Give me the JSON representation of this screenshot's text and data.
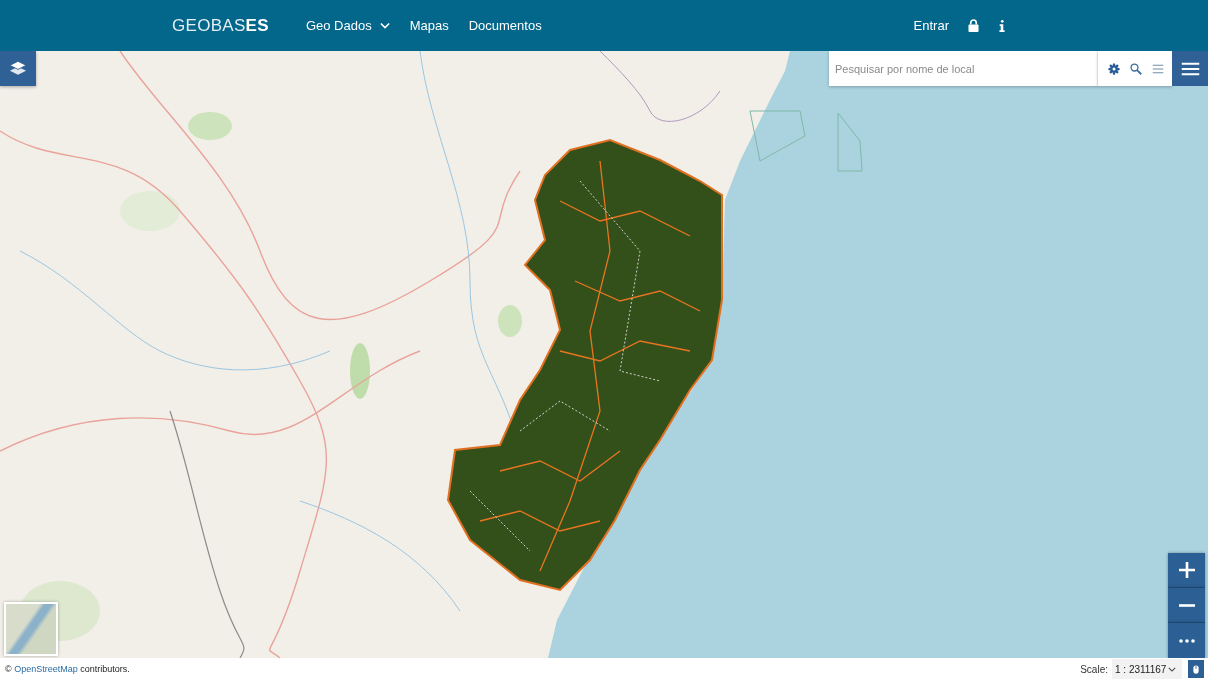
{
  "header": {
    "logo": "GEOBAS**ES**",
    "nav": [
      {
        "label": "Geo Dados",
        "kind": "dropdown"
      },
      {
        "label": "Mapas",
        "kind": "link"
      },
      {
        "label": "Documentos",
        "kind": "link"
      }
    ],
    "login": "Entrar"
  },
  "search": {
    "placeholder": "Pesquisar por nome de local"
  },
  "footer": {
    "attribution": {
      "prefix": "©",
      "link": "OpenStreetMap",
      "suffix": "contributors."
    },
    "scale_label": "Scale:",
    "scale_value": "1 : 2311167"
  }
}
